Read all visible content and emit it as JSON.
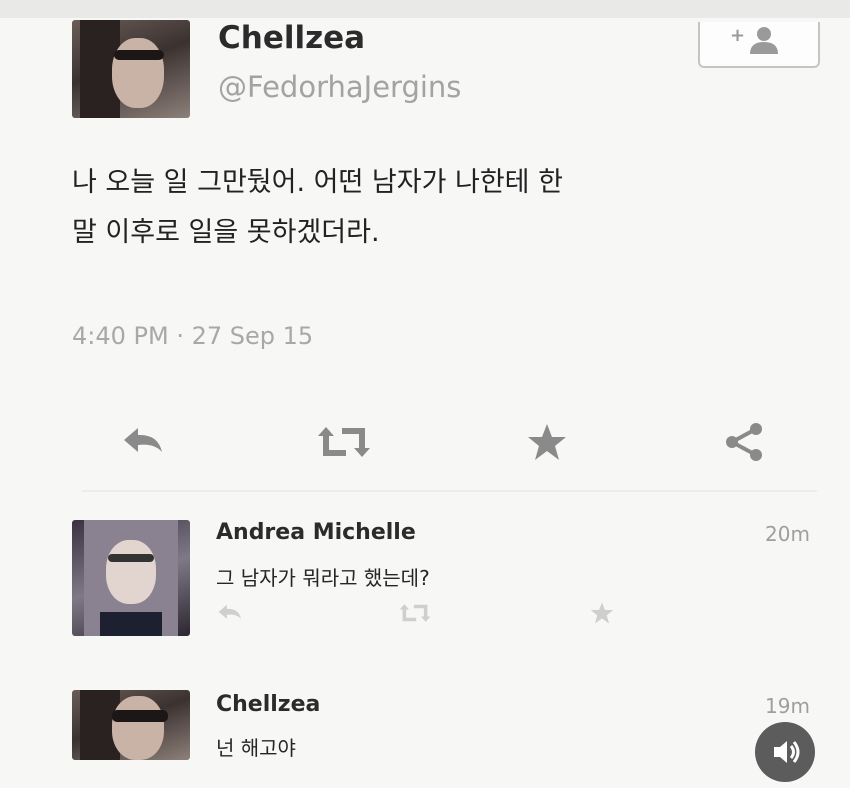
{
  "tweet": {
    "author_name": "Chellzea",
    "author_handle": "@FedorhaJergins",
    "text": "나 오늘 일 그만뒀어. 어떤 남자가 나한테 한\n말 이후로 일을 못하겠더라.",
    "timestamp": "4:40 PM · 27 Sep 15",
    "follow_icon": "add-user-icon",
    "actions": [
      "reply-icon",
      "retweet-icon",
      "favorite-star-icon",
      "share-icon"
    ]
  },
  "replies": [
    {
      "author_name": "Andrea Michelle",
      "time": "20m",
      "text": "그 남자가 뭐라고 했는데?",
      "actions": [
        "reply-icon",
        "retweet-icon",
        "favorite-star-icon"
      ]
    },
    {
      "author_name": "Chellzea",
      "time": "19m",
      "text": "넌 해고야"
    }
  ],
  "overlay": {
    "icon": "speaker-volume-icon"
  },
  "colors": {
    "background": "#f7f7f6",
    "icon_gray": "#8a8a8a",
    "sound_button": "#5c5c5c"
  }
}
